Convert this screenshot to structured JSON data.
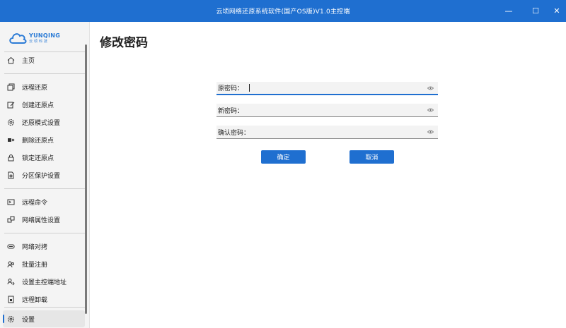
{
  "window": {
    "title": "云顷网络还原系统软件(国产OS版)V1.0主控端",
    "min_glyph": "—",
    "max_glyph": "☐",
    "close_glyph": "✕"
  },
  "logo": {
    "en": "YUNQING",
    "cn": "云顷科技"
  },
  "nav": {
    "items": [
      {
        "label": "主页",
        "icon": "home-icon"
      },
      {
        "label": "远程还原",
        "icon": "copy-icon"
      },
      {
        "label": "创建还原点",
        "icon": "edit-icon"
      },
      {
        "label": "还原模式设置",
        "icon": "gear-icon"
      },
      {
        "label": "删除还原点",
        "icon": "delete-icon"
      },
      {
        "label": "锁定还原点",
        "icon": "lock-icon"
      },
      {
        "label": "分区保护设置",
        "icon": "partition-icon"
      },
      {
        "label": "远程命令",
        "icon": "terminal-icon"
      },
      {
        "label": "网络属性设置",
        "icon": "network-icon"
      },
      {
        "label": "网络对拷",
        "icon": "copy-network-icon"
      },
      {
        "label": "批量注册",
        "icon": "users-icon"
      },
      {
        "label": "设置主控端地址",
        "icon": "address-icon"
      },
      {
        "label": "远程卸载",
        "icon": "uninstall-icon"
      },
      {
        "label": "设置",
        "icon": "settings-icon"
      }
    ],
    "active": "设置"
  },
  "page": {
    "title": "修改密码"
  },
  "form": {
    "old_password": {
      "label": "原密码：",
      "value": ""
    },
    "new_password": {
      "label": "新密码：",
      "value": ""
    },
    "confirm_password": {
      "label": "确认密码：",
      "value": ""
    }
  },
  "buttons": {
    "ok": "确定",
    "cancel": "取消"
  },
  "colors": {
    "accent": "#1f6fd0",
    "sidebar_bg": "#f4f4f4"
  }
}
